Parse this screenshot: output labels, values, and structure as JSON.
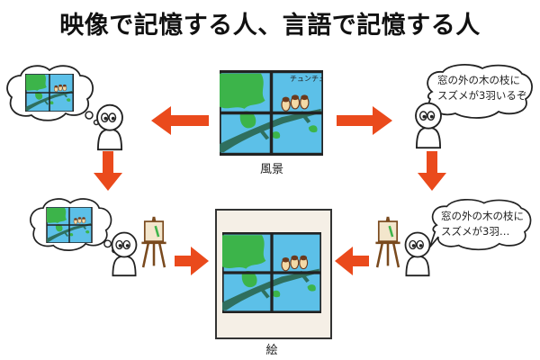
{
  "title": "映像で記憶する人、言語で記憶する人",
  "labels": {
    "scene": "風景",
    "picture": "絵"
  },
  "window_text": "チュンチュン",
  "speech": {
    "memory_verbal_line1": "窓の外の木の枝に",
    "memory_verbal_line2": "スズメが3羽いるぞ",
    "recall_verbal_line1": "窓の外の木の枝に",
    "recall_verbal_line2": "スズメが3羽…"
  },
  "colors": {
    "arrow": "#ea4a1c",
    "sky": "#5cc0e8",
    "tree": "#3cb44a",
    "branch": "#2f6f5e",
    "frame": "#333333",
    "canvas_bg": "#f5efe6"
  },
  "icons": [
    "thought-bubble-icon",
    "speech-bubble-icon",
    "person-icon",
    "easel-icon",
    "window-scene-icon",
    "sparrow-icon"
  ]
}
